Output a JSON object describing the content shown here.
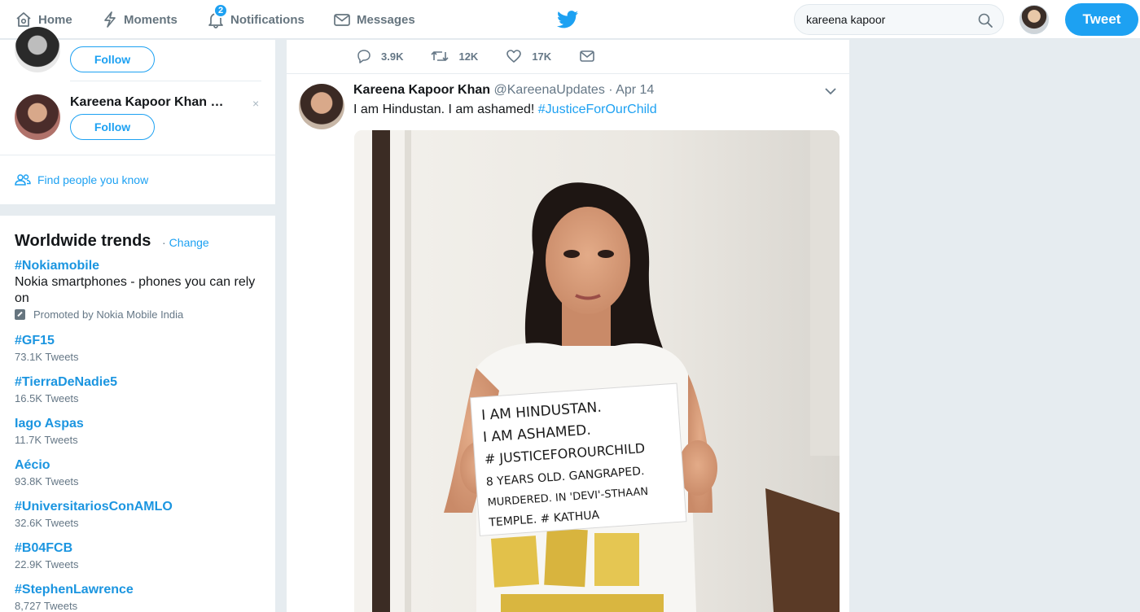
{
  "nav": {
    "home": "Home",
    "moments": "Moments",
    "notifications": "Notifications",
    "notifications_badge": "2",
    "messages": "Messages"
  },
  "search": {
    "value": "kareena kapoor"
  },
  "tweet_button": "Tweet",
  "who_to_follow": {
    "follow_label": "Follow",
    "second_name": "Kareena Kapoor Khan …",
    "dismiss_glyph": "×",
    "find_people": "Find people you know"
  },
  "trends": {
    "title": "Worldwide trends",
    "change": "Change",
    "separator": "·",
    "promoted": {
      "name": "#Nokiamobile",
      "description": "Nokia smartphones - phones you can rely on",
      "promoted_by": "Promoted by Nokia Mobile India"
    },
    "items": [
      {
        "name": "#GF15",
        "count": "73.1K Tweets"
      },
      {
        "name": "#TierraDeNadie5",
        "count": "16.5K Tweets"
      },
      {
        "name": "Iago Aspas",
        "count": "11.7K Tweets"
      },
      {
        "name": "Aécio",
        "count": "93.8K Tweets"
      },
      {
        "name": "#UniversitariosConAMLO",
        "count": "32.6K Tweets"
      },
      {
        "name": "#B04FCB",
        "count": "22.9K Tweets"
      },
      {
        "name": "#StephenLawrence",
        "count": "8,727 Tweets"
      }
    ]
  },
  "prev_tweet_actions": {
    "replies": "3.9K",
    "retweets": "12K",
    "likes": "17K"
  },
  "tweet": {
    "name": "Kareena Kapoor Khan",
    "handle": "@KareenaUpdates",
    "separator": "·",
    "date": "Apr 14",
    "text": "I am Hindustan. I am ashamed! ",
    "hashtag": "#JusticeForOurChild"
  },
  "placard": {
    "line1": "I AM HINDUSTAN.",
    "line2": "I AM ASHAMED.",
    "line3": "# JUSTICEFOROURCHILD",
    "line4": "8 YEARS OLD. GANGRAPED.",
    "line5": "MURDERED. IN 'DEVI'-STHAAN",
    "line6": "TEMPLE. # KATHUA"
  },
  "colors": {
    "accent": "#1da1f2",
    "background": "#e6ecf0"
  }
}
